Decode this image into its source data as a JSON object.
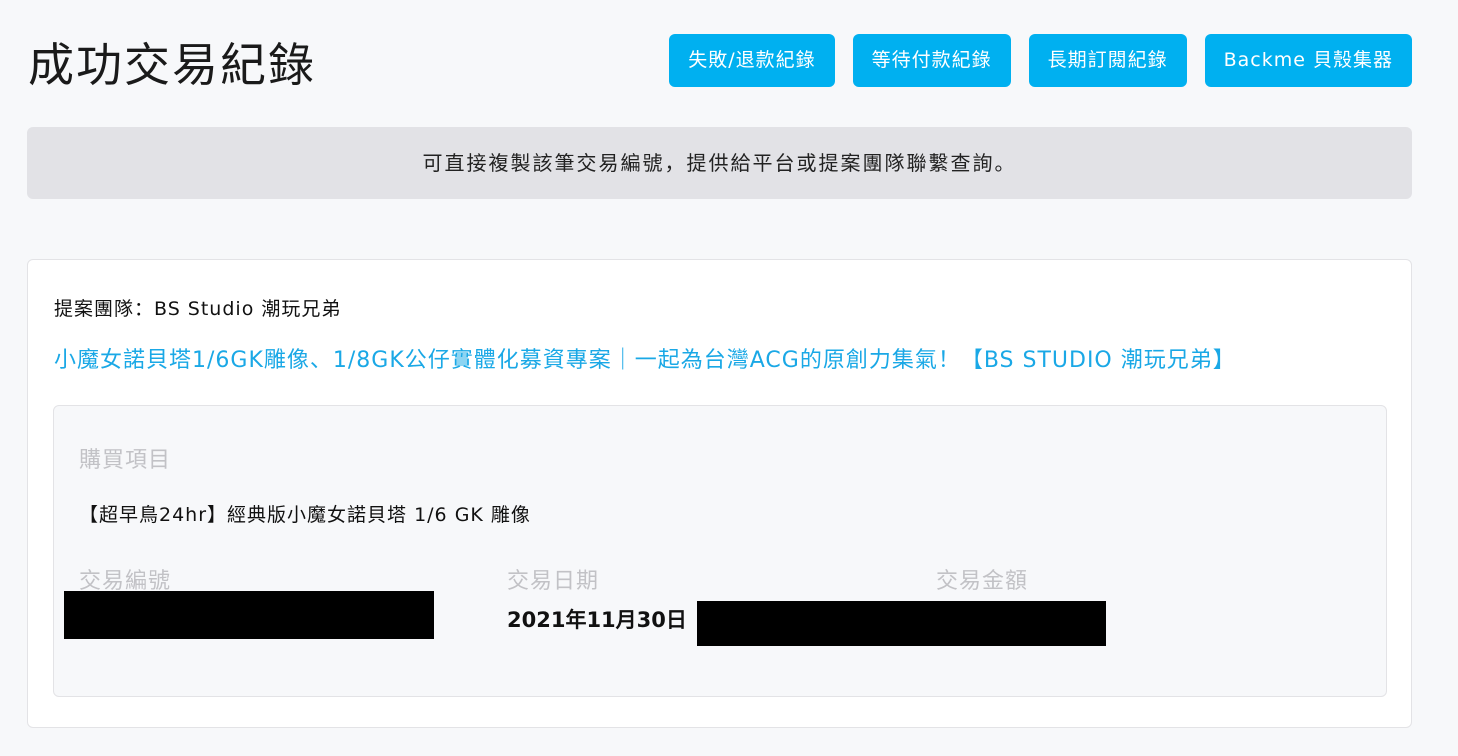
{
  "header": {
    "title": "成功交易紀錄",
    "buttons": [
      {
        "label": "失敗/退款紀錄"
      },
      {
        "label": "等待付款紀錄"
      },
      {
        "label": "長期訂閱紀錄"
      },
      {
        "label": "Backme 貝殼集器"
      }
    ]
  },
  "notice": {
    "text": "可直接複製該筆交易編號，提供給平台或提案團隊聯繫查詢。"
  },
  "transaction": {
    "team_line": "提案團隊：BS Studio 潮玩兄弟",
    "project_title": "小魔女諾貝塔1/6GK雕像、1/8GK公仔實體化募資專案｜一起為台灣ACG的原創力集氣！【BS STUDIO 潮玩兄弟】",
    "purchase_label": "購買項目",
    "item_name": "【超早鳥24hr】經典版小魔女諾貝塔 1/6 GK 雕像",
    "id_label": "交易編號",
    "date_label": "交易日期",
    "amount_label": "交易金額",
    "date_value": "2021年11月30日"
  },
  "colors": {
    "accent": "#00b0f0",
    "link": "#1aa8e6",
    "banner_bg": "#e2e2e6",
    "muted_label": "#c2c2c6"
  }
}
